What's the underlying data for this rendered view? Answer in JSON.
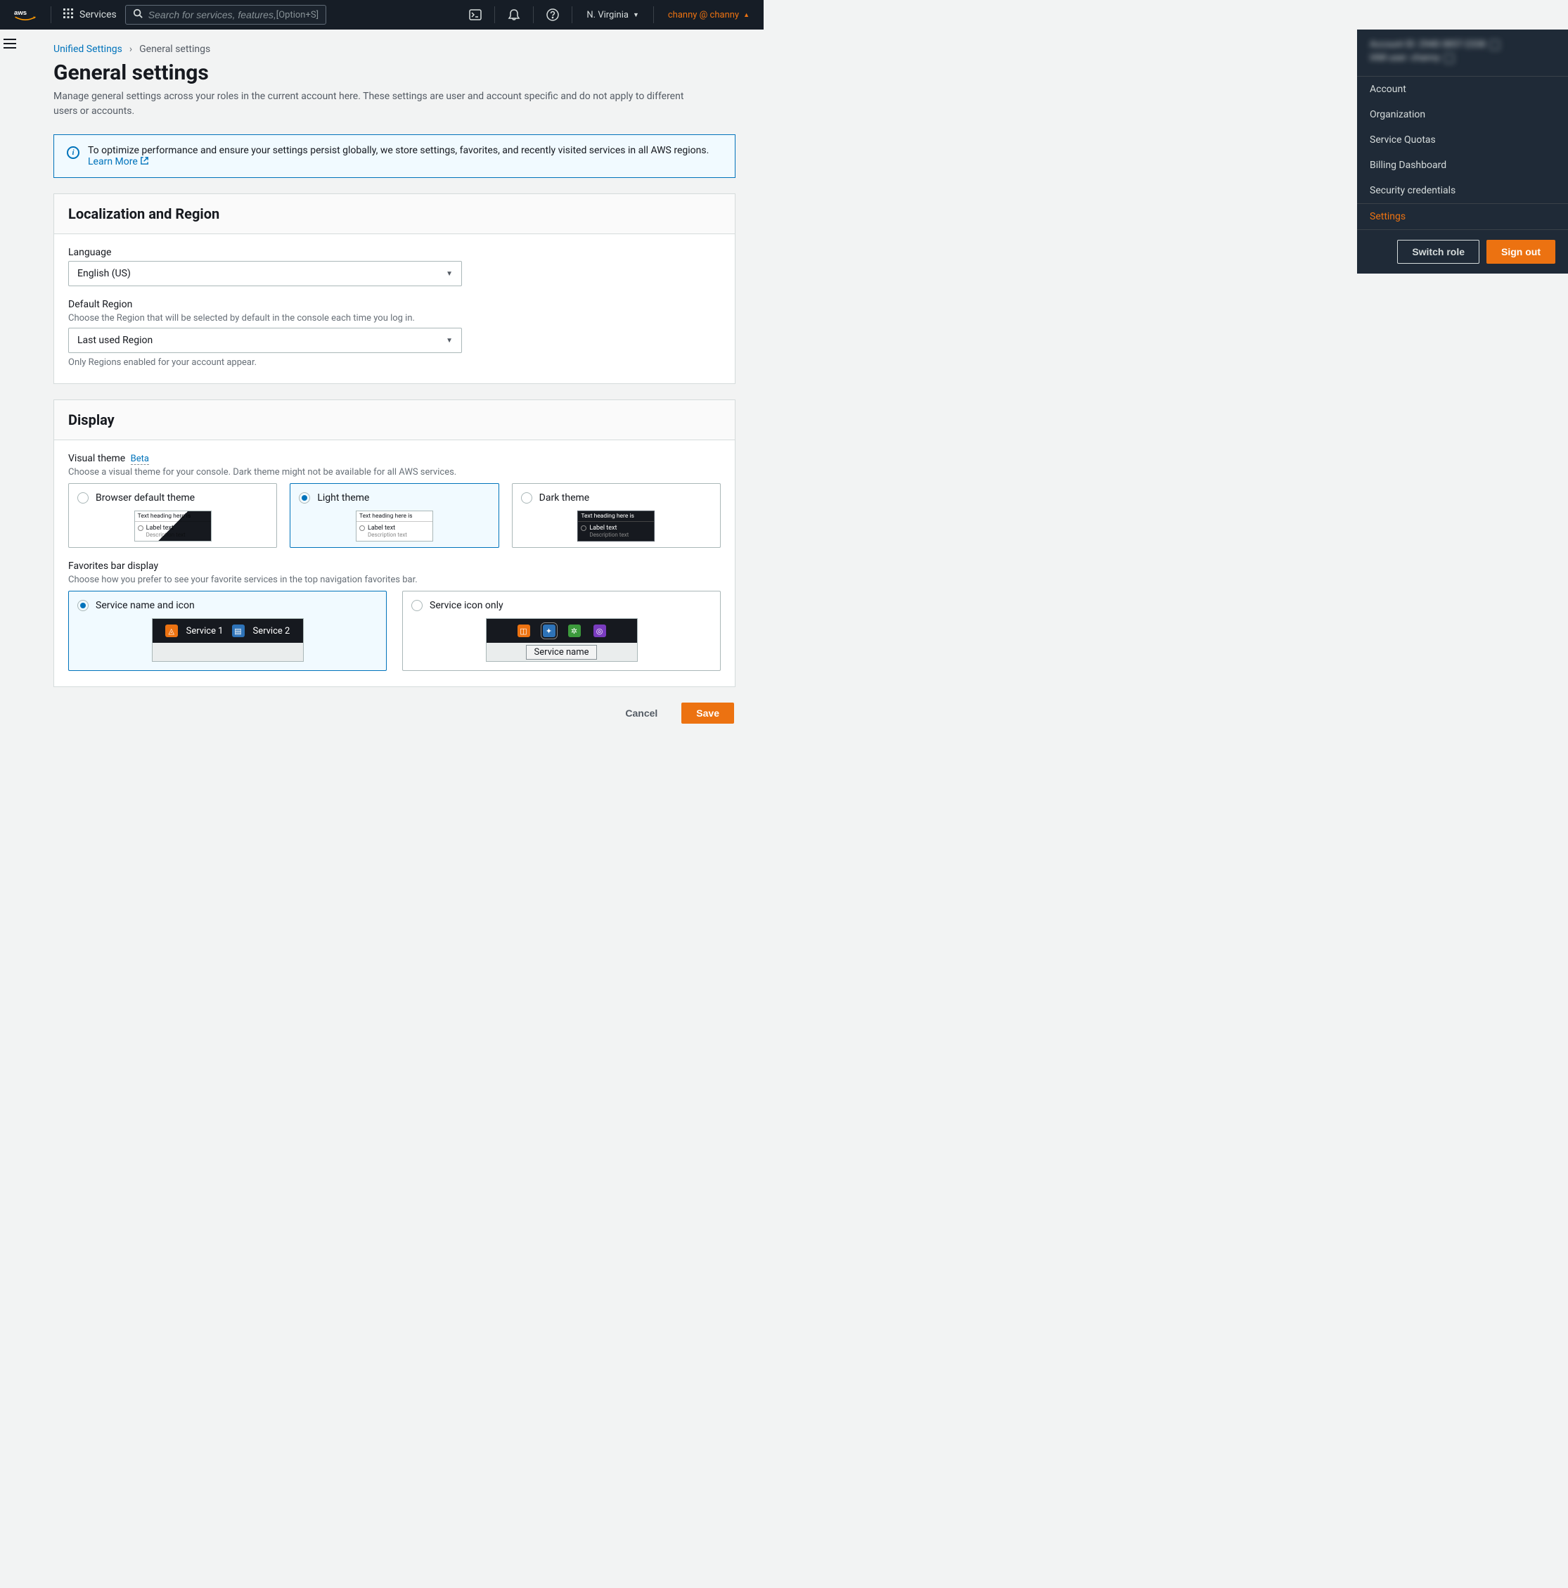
{
  "nav": {
    "services_label": "Services",
    "search_placeholder": "Search for services, features, blogs, docs, and more",
    "search_hint": "[Option+S]",
    "region": "N. Virginia",
    "user": "channy @ channy"
  },
  "breadcrumbs": {
    "root": "Unified Settings",
    "page": "General settings"
  },
  "page": {
    "title": "General settings",
    "subtitle": "Manage general settings across your roles in the current account here. These settings are user and account specific and do not apply to different users or accounts."
  },
  "banner": {
    "text": "To optimize performance and ensure your settings persist globally, we store settings, favorites, and recently visited services in all AWS regions.",
    "link": "Learn More"
  },
  "localization": {
    "title": "Localization and Region",
    "language_label": "Language",
    "language_value": "English (US)",
    "region_label": "Default Region",
    "region_desc": "Choose the Region that will be selected by default in the console each time you log in.",
    "region_value": "Last used Region",
    "region_note": "Only Regions enabled for your account appear."
  },
  "display": {
    "title": "Display",
    "visual_theme_label": "Visual theme",
    "beta": "Beta",
    "visual_theme_desc": "Choose a visual theme for your console. Dark theme might not be available for all AWS services.",
    "themes": {
      "browser": "Browser default theme",
      "light": "Light theme",
      "dark": "Dark theme",
      "preview_heading": "Text heading here is",
      "preview_label": "Label text",
      "preview_desc": "Description text"
    },
    "fav_label": "Favorites bar display",
    "fav_desc": "Choose how you prefer to see your favorite services in the top navigation favorites bar.",
    "fav_name_icon": "Service name and icon",
    "fav_icon_only": "Service icon only",
    "service1": "Service 1",
    "service2": "Service 2",
    "service_name_tooltip": "Service name"
  },
  "actions": {
    "cancel": "Cancel",
    "save": "Save"
  },
  "account_menu": {
    "account_id_line": "Account ID: 2940-3857-2338",
    "iam_user_line": "IAM user: channy",
    "items": {
      "account": "Account",
      "organization": "Organization",
      "service_quotas": "Service Quotas",
      "billing": "Billing Dashboard",
      "security": "Security credentials",
      "settings": "Settings"
    },
    "switch_role": "Switch role",
    "sign_out": "Sign out"
  }
}
